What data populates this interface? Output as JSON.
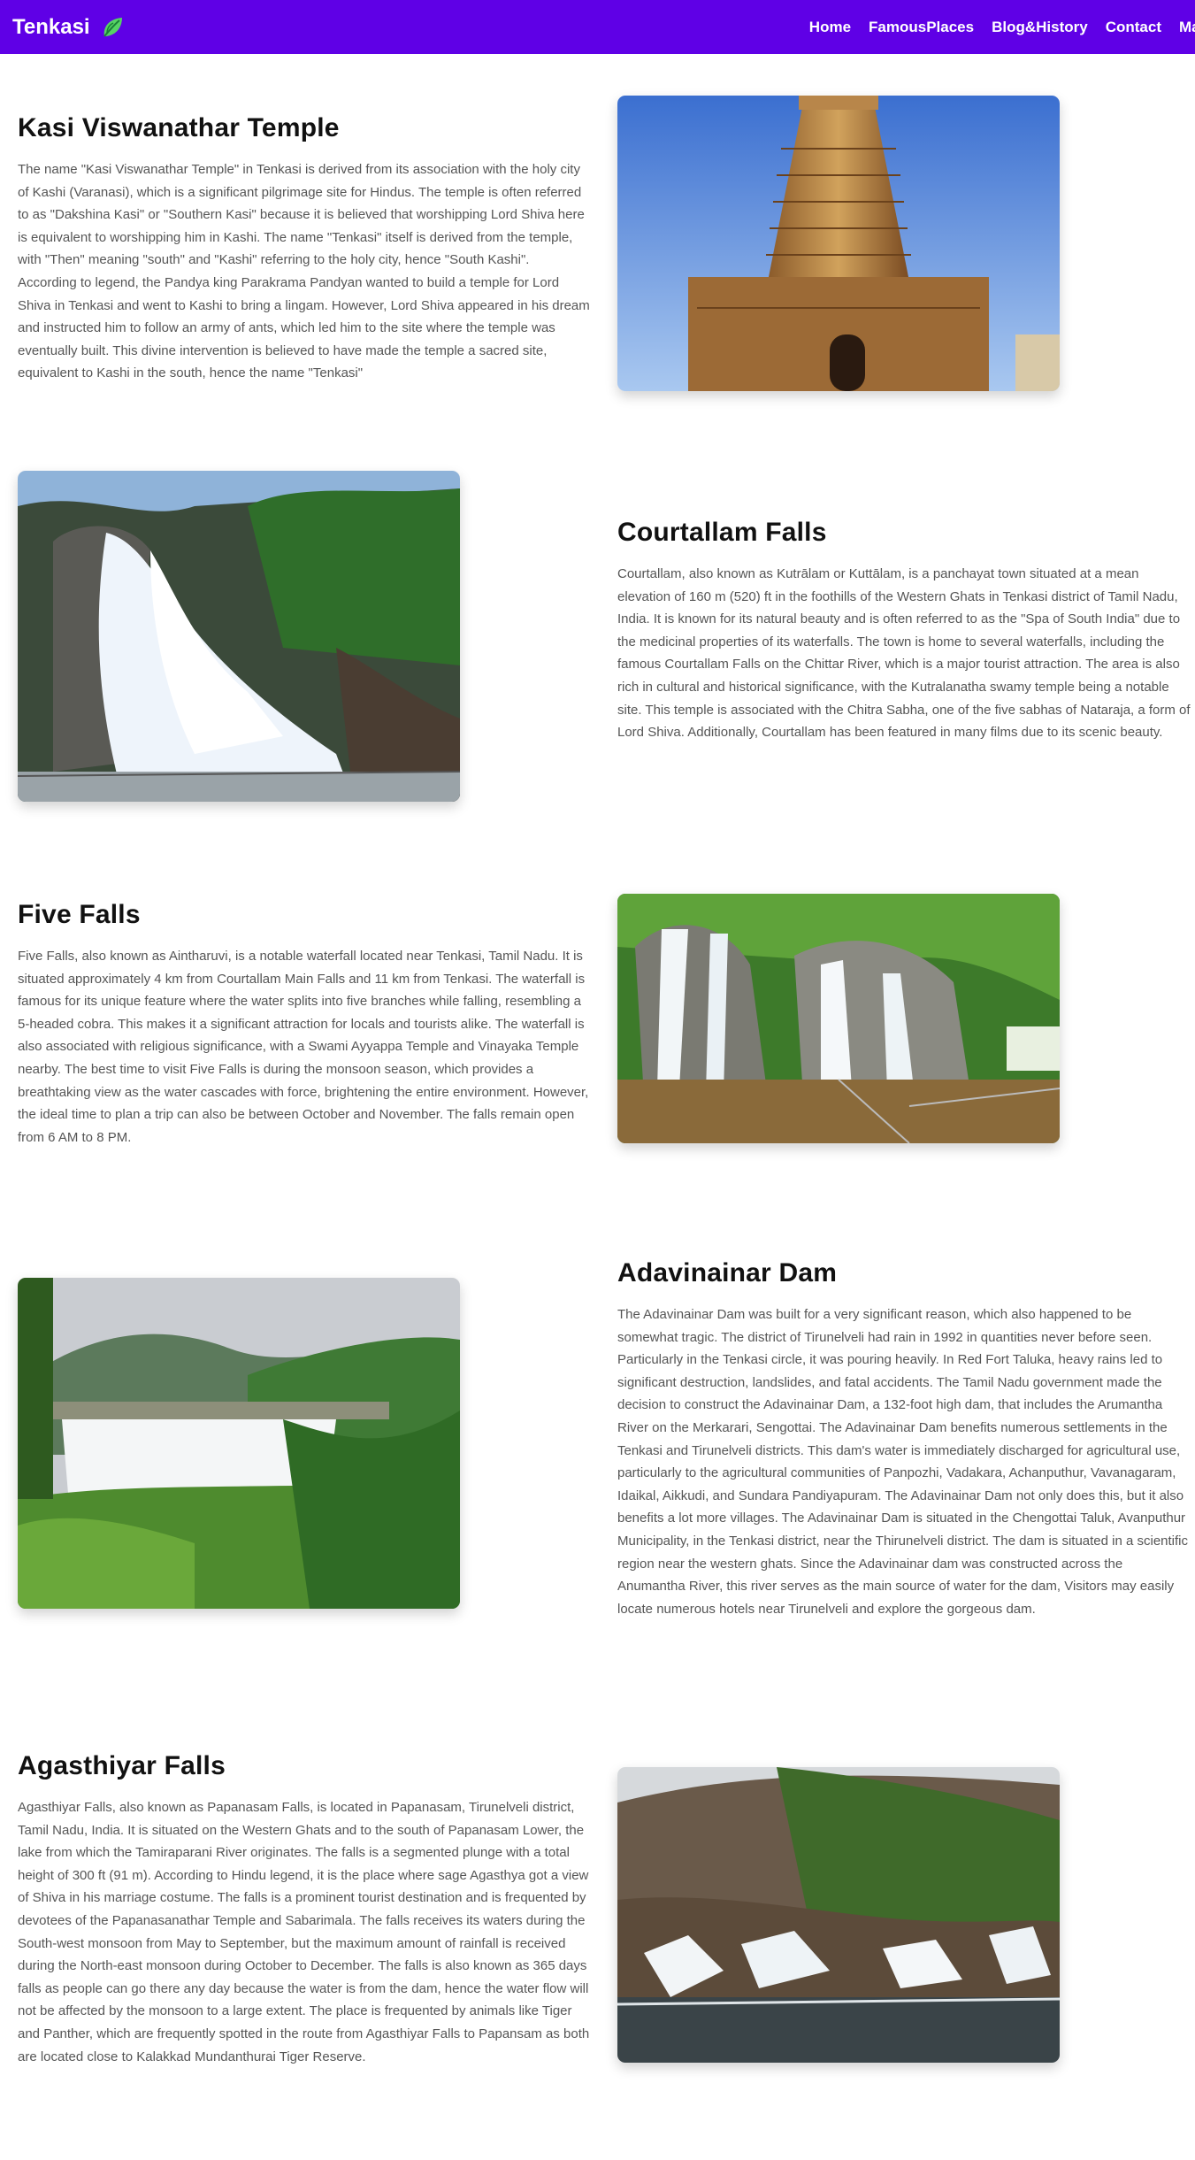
{
  "header": {
    "brand": "Tenkasi",
    "brand_icon": "leaf-icon",
    "nav": [
      "Home",
      "FamousPlaces",
      "Blog&History",
      "Contact",
      "Map"
    ]
  },
  "colors": {
    "navbar": "#5f00e6",
    "leaf_dark": "#1a7f37",
    "leaf_light": "#56d364"
  },
  "places": [
    {
      "title": "Kasi Viswanathar Temple",
      "description": "The name \"Kasi Viswanathar Temple\" in Tenkasi is derived from its association with the holy city of Kashi (Varanasi), which is a significant pilgrimage site for Hindus. The temple is often referred to as \"Dakshina Kasi\" or \"Southern Kasi\" because it is believed that worshipping Lord Shiva here is equivalent to worshipping him in Kashi. The name \"Tenkasi\" itself is derived from the temple, with \"Then\" meaning \"south\" and \"Kashi\" referring to the holy city, hence \"South Kashi\". According to legend, the Pandya king Parakrama Pandyan wanted to build a temple for Lord Shiva in Tenkasi and went to Kashi to bring a lingam. However, Lord Shiva appeared in his dream and instructed him to follow an army of ants, which led him to the site where the temple was eventually built. This divine intervention is believed to have made the temple a sacred site, equivalent to Kashi in the south, hence the name \"Tenkasi\"",
      "image": "temple-gopuram"
    },
    {
      "title": "Courtallam Falls",
      "description": "Courtallam, also known as Kutrālam or Kuttālam, is a panchayat town situated at a mean elevation of 160 m (520) ft in the foothills of the Western Ghats in Tenkasi district of Tamil Nadu, India. It is known for its natural beauty and is often referred to as the \"Spa of South India\" due to the medicinal properties of its waterfalls. The town is home to several waterfalls, including the famous Courtallam Falls on the Chittar River, which is a major tourist attraction. The area is also rich in cultural and historical significance, with the Kutralanatha swamy temple being a notable site. This temple is associated with the Chitra Sabha, one of the five sabhas of Nataraja, a form of Lord Shiva. Additionally, Courtallam has been featured in many films due to its scenic beauty.",
      "image": "courtallam-waterfall"
    },
    {
      "title": "Five Falls",
      "description": "Five Falls, also known as Aintharuvi, is a notable waterfall located near Tenkasi, Tamil Nadu. It is situated approximately 4 km from Courtallam Main Falls and 11 km from Tenkasi. The waterfall is famous for its unique feature where the water splits into five branches while falling, resembling a 5-headed cobra. This makes it a significant attraction for locals and tourists alike. The waterfall is also associated with religious significance, with a Swami Ayyappa Temple and Vinayaka Temple nearby. The best time to visit Five Falls is during the monsoon season, which provides a breathtaking view as the water cascades with force, brightening the entire environment. However, the ideal time to plan a trip can also be between October and November. The falls remain open from 6 AM to 8 PM.",
      "image": "five-falls"
    },
    {
      "title": "Adavinainar Dam",
      "description": "The Adavinainar Dam was built for a very significant reason, which also happened to be somewhat tragic. The district of Tirunelveli had rain in 1992 in quantities never before seen. Particularly in the Tenkasi circle, it was pouring heavily. In Red Fort Taluka, heavy rains led to significant destruction, landslides, and fatal accidents. The Tamil Nadu government made the decision to construct the Adavinainar Dam, a 132-foot high dam, that includes the Arumantha River on the Merkarari, Sengottai. The Adavinainar Dam benefits numerous settlements in the Tenkasi and Tirunelveli districts. This dam's water is immediately discharged for agricultural use, particularly to the agricultural communities of Panpozhi, Vadakara, Achanputhur, Vavanagaram, Idaikal, Aikkudi, and Sundara Pandiyapuram. The Adavinainar Dam not only does this, but it also benefits a lot more villages. The Adavinainar Dam is situated in the Chengottai Taluk, Avanputhur Municipality, in the Tenkasi district, near the Thirunelveli district. The dam is situated in a scientific region near the western ghats. Since the Adavinainar dam was constructed across the Anumantha River, this river serves as the main source of water for the dam, Visitors may easily locate numerous hotels near Tirunelveli and explore the gorgeous dam.",
      "image": "dam-landscape"
    },
    {
      "title": "Agasthiyar Falls",
      "description": "Agasthiyar Falls, also known as Papanasam Falls, is located in Papanasam, Tirunelveli district, Tamil Nadu, India. It is situated on the Western Ghats and to the south of Papanasam Lower, the lake from which the Tamiraparani River originates. The falls is a segmented plunge with a total height of 300 ft (91 m). According to Hindu legend, it is the place where sage Agasthya got a view of Shiva in his marriage costume. The falls is a prominent tourist destination and is frequented by devotees of the Papanasanathar Temple and Sabarimala. The falls receives its waters during the South-west monsoon from May to September, but the maximum amount of rainfall is received during the North-east monsoon during October to December. The falls is also known as 365 days falls as people can go there any day because the water is from the dam, hence the water flow will not be affected by the monsoon to a large extent. The place is frequented by animals like Tiger and Panther, which are frequently spotted in the route from Agasthiyar Falls to Papansam as both are located close to Kalakkad Mundanthurai Tiger Reserve.",
      "image": "agasthiyar-falls"
    }
  ]
}
